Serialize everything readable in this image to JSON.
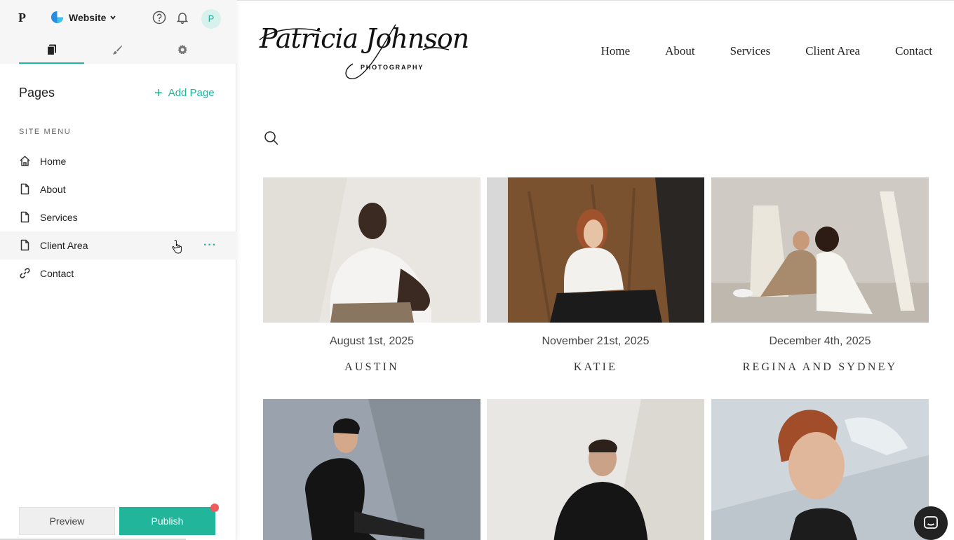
{
  "editor": {
    "brand_letter": "P",
    "site_name": "Website",
    "avatar_letter": "P",
    "tabs": [
      {
        "name": "pages",
        "icon": "pages-icon",
        "active": true
      },
      {
        "name": "design",
        "icon": "brush-icon",
        "active": false
      },
      {
        "name": "settings",
        "icon": "gear-icon",
        "active": false
      }
    ],
    "pages_title": "Pages",
    "add_page_label": "Add Page",
    "section_label": "SITE MENU",
    "menu_items": [
      {
        "label": "Home",
        "icon": "home-icon"
      },
      {
        "label": "About",
        "icon": "page-icon"
      },
      {
        "label": "Services",
        "icon": "page-icon"
      },
      {
        "label": "Client Area",
        "icon": "page-icon",
        "hovered": true
      },
      {
        "label": "Contact",
        "icon": "link-icon"
      }
    ],
    "more_dots": "···",
    "preview_label": "Preview",
    "publish_label": "Publish",
    "accent_color": "#1fb59a"
  },
  "site": {
    "logo_name": "Patricia Johnson",
    "logo_sub": "PHOTOGRAPHY",
    "nav": [
      "Home",
      "About",
      "Services",
      "Client Area",
      "Contact"
    ],
    "galleries": [
      {
        "date": "August 1st, 2025",
        "name": "AUSTIN"
      },
      {
        "date": "November 21st, 2025",
        "name": "KATIE"
      },
      {
        "date": "December 4th, 2025",
        "name": "REGINA AND SYDNEY"
      },
      {
        "date": "",
        "name": ""
      },
      {
        "date": "",
        "name": ""
      },
      {
        "date": "",
        "name": ""
      }
    ]
  }
}
